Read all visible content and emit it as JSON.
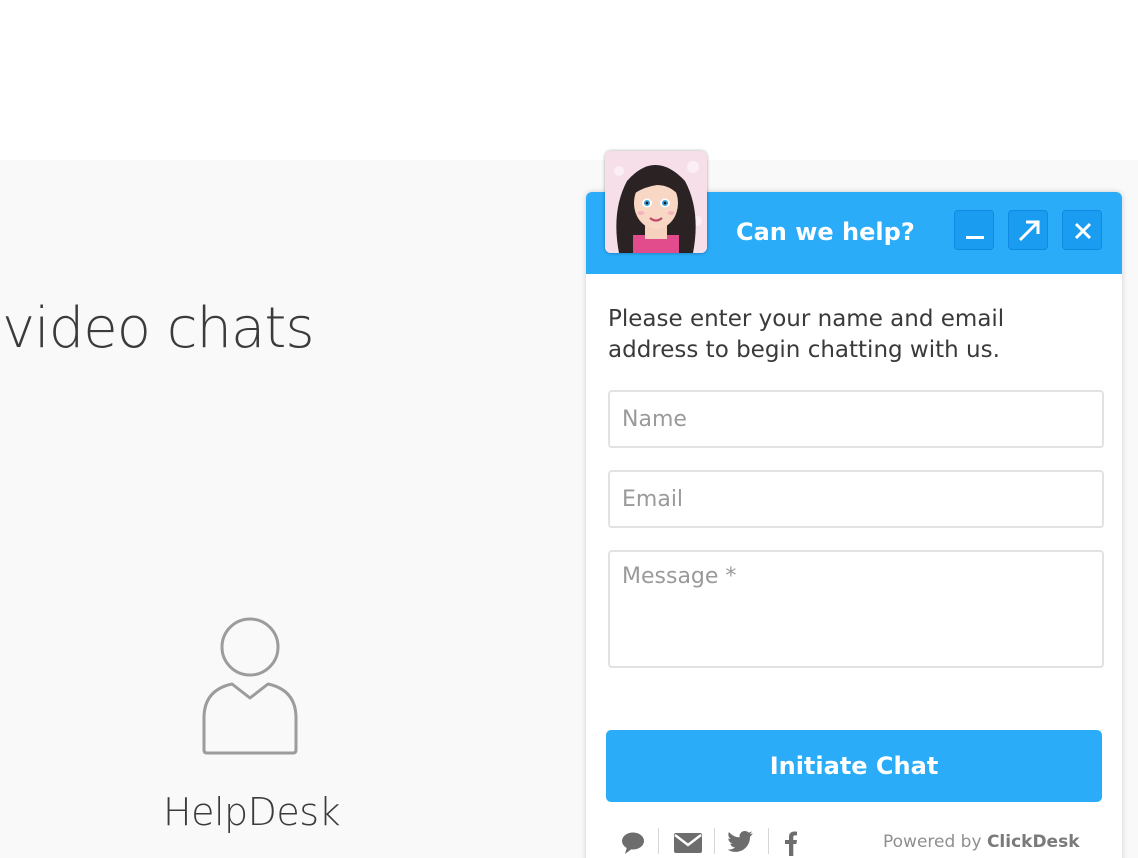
{
  "page": {
    "hero_title": "video chats",
    "helpdesk_label": "HelpDesk"
  },
  "chat": {
    "header_title": "Can we help?",
    "intro": "Please enter your name and email address to begin chatting with us.",
    "name_placeholder": "Name",
    "email_placeholder": "Email",
    "message_placeholder": "Message *",
    "button_label": "Initiate Chat",
    "powered_prefix": "Powered by",
    "powered_brand": "ClickDesk",
    "colors": {
      "accent": "#2aacf8",
      "accent_dark": "#1a9cf0"
    },
    "header_buttons": [
      "minimize-icon",
      "popout-icon",
      "close-icon"
    ],
    "footer_icons": [
      "chat-bubble-icon",
      "email-icon",
      "twitter-icon",
      "facebook-icon"
    ]
  }
}
